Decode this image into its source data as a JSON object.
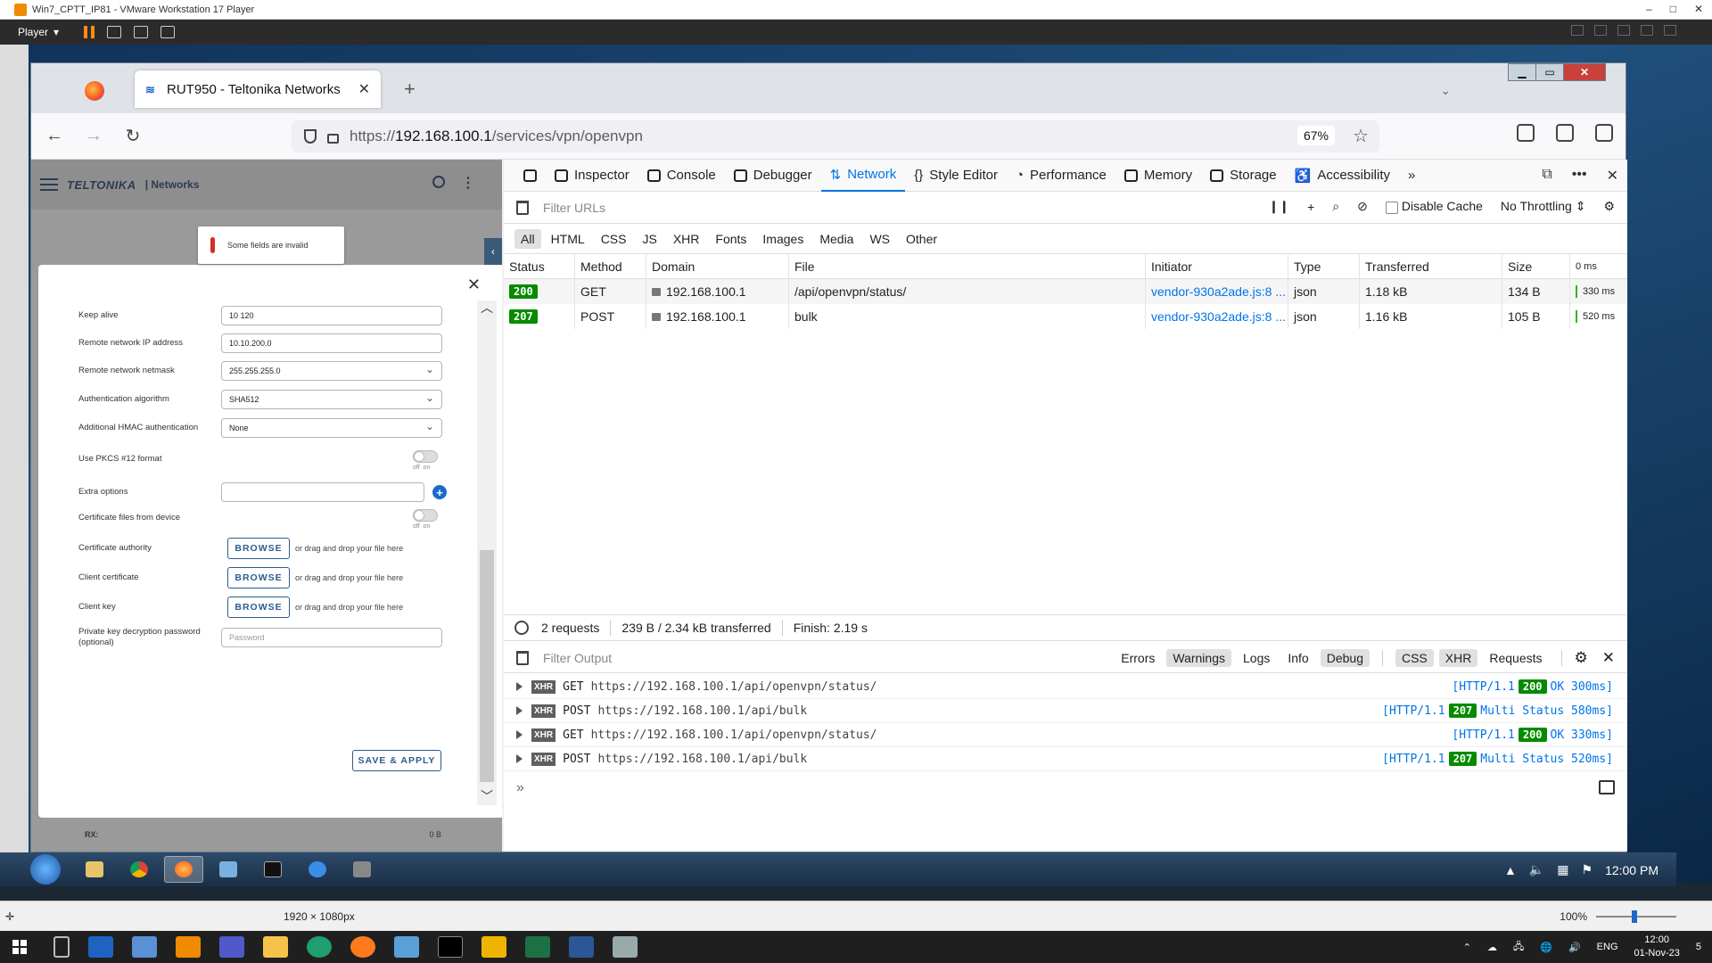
{
  "vm": {
    "title": "Win7_CPTT_IP81 - VMware Workstation 17 Player",
    "player_label": "Player",
    "status_resolution": "1920 × 1080px",
    "zoom": "100%"
  },
  "firefox": {
    "tab_title": "RUT950 - Teltonika Networks",
    "url_prefix": "https://",
    "url_host": "192.168.100.1",
    "url_path": "/services/vpn/openvpn",
    "zoom": "67%"
  },
  "router": {
    "brand": "TELTONIKA",
    "brand_sub": "| Networks",
    "toast": "Some fields are invalid",
    "fields": [
      {
        "label": "Keep alive",
        "value": "10 120"
      },
      {
        "label": "Remote network IP address",
        "value": "10.10.200.0"
      },
      {
        "label": "Remote network netmask",
        "value": "255.255.255.0"
      },
      {
        "label": "Authentication algorithm",
        "value": "SHA512"
      },
      {
        "label": "Additional HMAC authentication",
        "value": "None"
      },
      {
        "label": "Use PKCS #12 format"
      },
      {
        "label": "Extra options",
        "value": ""
      },
      {
        "label": "Certificate files from device"
      },
      {
        "label": "Certificate authority"
      },
      {
        "label": "Client certificate"
      },
      {
        "label": "Client key"
      },
      {
        "label": "Private key decryption password (optional)",
        "placeholder": "Password"
      }
    ],
    "toggle_off": "off",
    "toggle_on": "on",
    "browse_label": "BROWSE",
    "drag_note": "or drag and drop your file here",
    "save_label": "SAVE & APPLY",
    "rx_label": "RX:",
    "rx_value": "0 B"
  },
  "devtools": {
    "tabs": [
      "Inspector",
      "Console",
      "Debugger",
      "Network",
      "Style Editor",
      "Performance",
      "Memory",
      "Storage",
      "Accessibility"
    ],
    "filter_placeholder": "Filter URLs",
    "disable_cache": "Disable Cache",
    "throttling": "No Throttling",
    "type_filters": [
      "All",
      "HTML",
      "CSS",
      "JS",
      "XHR",
      "Fonts",
      "Images",
      "Media",
      "WS",
      "Other"
    ],
    "columns": [
      "Status",
      "Method",
      "Domain",
      "File",
      "Initiator",
      "Type",
      "Transferred",
      "Size",
      "0 ms"
    ],
    "requests": [
      {
        "status": "200",
        "method": "GET",
        "domain": "192.168.100.1",
        "file": "/api/openvpn/status/",
        "initiator": "vendor-930a2ade.js:8 ...",
        "type": "json",
        "transferred": "1.18 kB",
        "size": "134 B",
        "time": "330 ms"
      },
      {
        "status": "207",
        "method": "POST",
        "domain": "192.168.100.1",
        "file": "bulk",
        "initiator": "vendor-930a2ade.js:8 ...",
        "type": "json",
        "transferred": "1.16 kB",
        "size": "105 B",
        "time": "520 ms"
      }
    ],
    "summary": {
      "requests": "2 requests",
      "transferred": "239 B / 2.34 kB transferred",
      "finish": "Finish: 2.19 s"
    },
    "console_filter": "Filter Output",
    "console_levels": [
      "Errors",
      "Warnings",
      "Logs",
      "Info",
      "Debug"
    ],
    "console_types": [
      "CSS",
      "XHR",
      "Requests"
    ],
    "console_rows": [
      {
        "method": "GET",
        "url": "https://192.168.100.1/api/openvpn/status/",
        "proto": "[HTTP/1.1",
        "code": "200",
        "text": "OK 300ms]"
      },
      {
        "method": "POST",
        "url": "https://192.168.100.1/api/bulk",
        "proto": "[HTTP/1.1",
        "code": "207",
        "text": "Multi Status 580ms]"
      },
      {
        "method": "GET",
        "url": "https://192.168.100.1/api/openvpn/status/",
        "proto": "[HTTP/1.1",
        "code": "200",
        "text": "OK 330ms]"
      },
      {
        "method": "POST",
        "url": "https://192.168.100.1/api/bulk",
        "proto": "[HTTP/1.1",
        "code": "207",
        "text": "Multi Status 520ms]"
      }
    ],
    "xhr_tag": "XHR"
  },
  "guest_taskbar": {
    "clock": "12:00 PM"
  },
  "host_taskbar": {
    "lang": "ENG",
    "time": "12:00",
    "date": "01-Nov-23",
    "notif": "5"
  }
}
